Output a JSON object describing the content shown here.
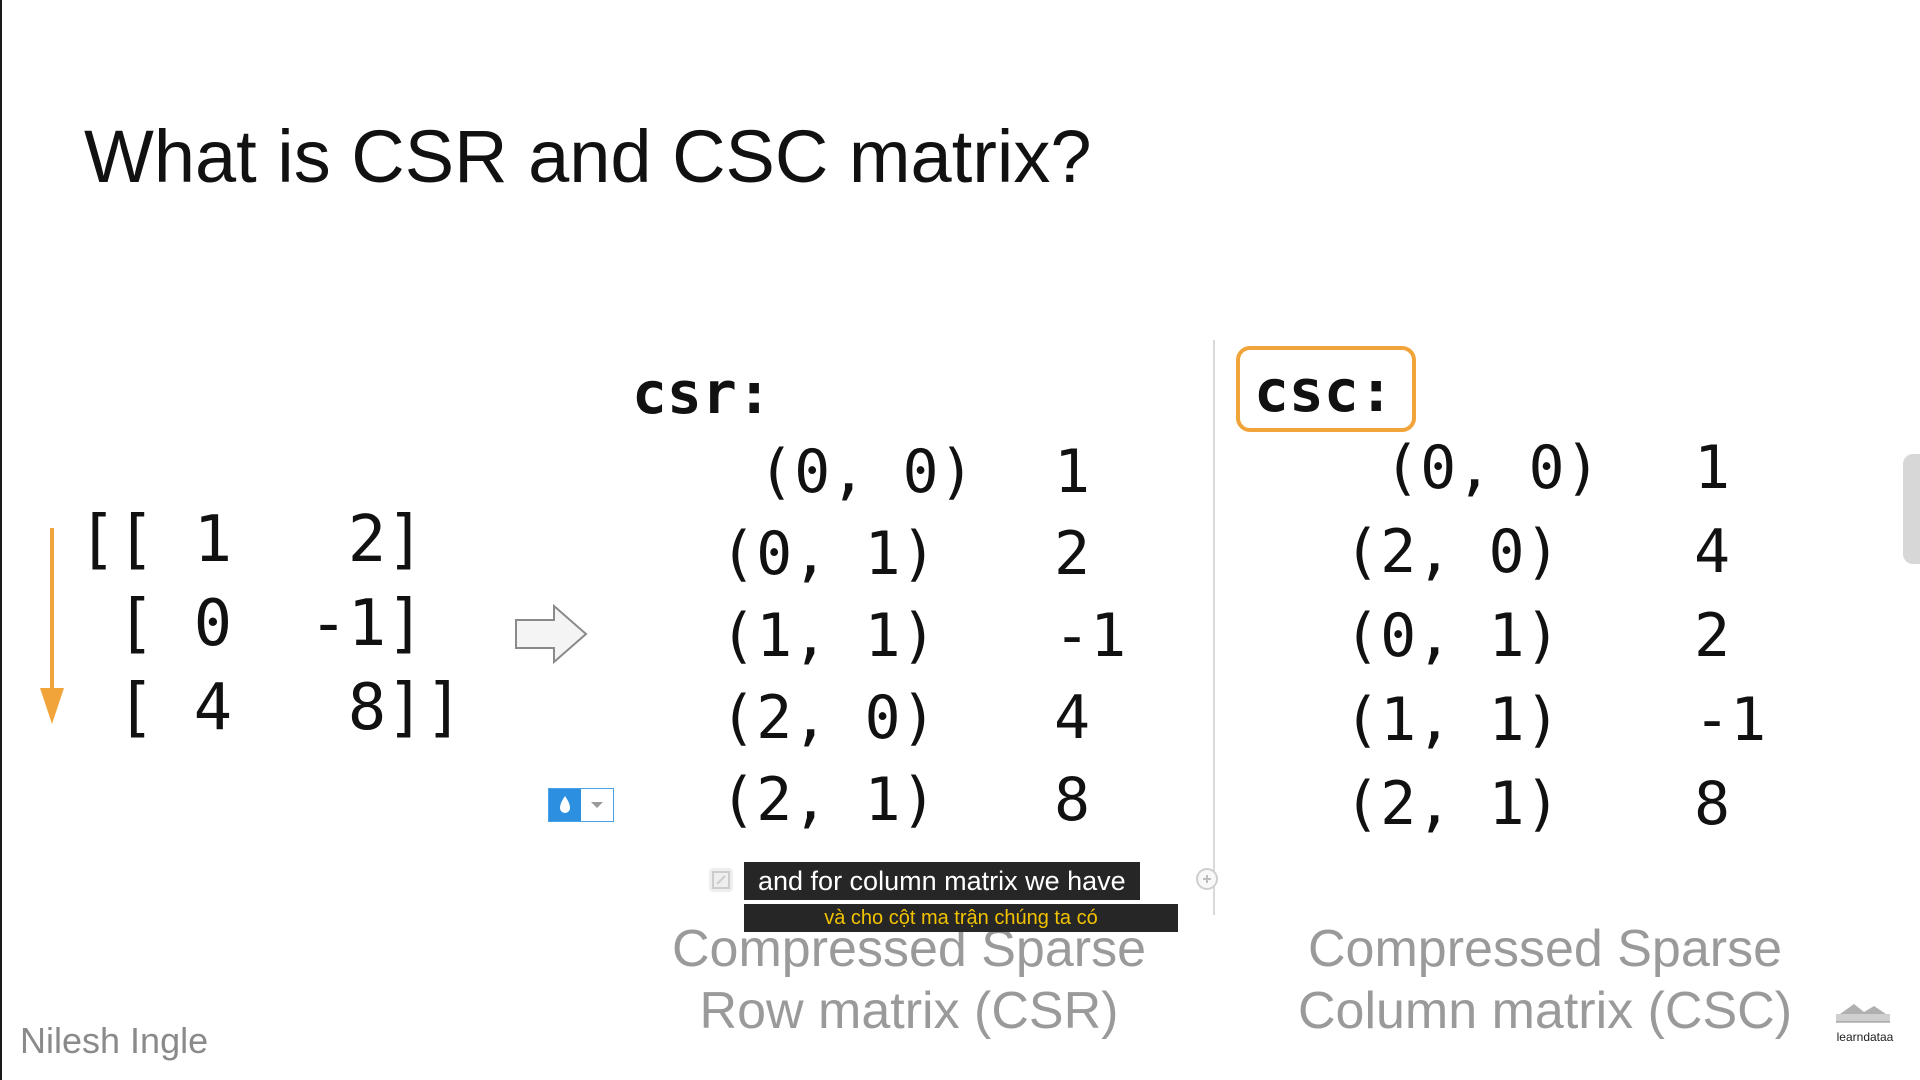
{
  "slide": {
    "title": "What is CSR and CSC matrix?",
    "author": "Nilesh Ingle"
  },
  "matrix": {
    "rows": [
      "[[ 1   2]",
      " [ 0  -1]",
      " [ 4   8]]"
    ]
  },
  "csr": {
    "label": "csr:",
    "entries": [
      {
        "coord": "(0, 0)",
        "value": "1"
      },
      {
        "coord": "(0, 1)",
        "value": "2"
      },
      {
        "coord": "(1, 1)",
        "value": "-1"
      },
      {
        "coord": "(2, 0)",
        "value": "4"
      },
      {
        "coord": "(2, 1)",
        "value": "8"
      }
    ],
    "caption_line1": "Compressed Sparse",
    "caption_line2": "Row matrix (CSR)"
  },
  "csc": {
    "label": "csc:",
    "entries": [
      {
        "coord": "(0, 0)",
        "value": "1"
      },
      {
        "coord": "(2, 0)",
        "value": "4"
      },
      {
        "coord": "(0, 1)",
        "value": "2"
      },
      {
        "coord": "(1, 1)",
        "value": "-1"
      },
      {
        "coord": "(2, 1)",
        "value": "8"
      }
    ],
    "caption_line1": "Compressed Sparse",
    "caption_line2": "Column matrix (CSC)"
  },
  "subtitles": {
    "english": "and for column matrix we have",
    "vietnamese": "và cho cột ma trận chúng ta có"
  },
  "logo": {
    "text": "learndataa"
  },
  "colors": {
    "accent_orange": "#f0a43a",
    "widget_blue": "#2d8fe0",
    "subtitle_yellow": "#f2c200",
    "caption_gray": "#9a9a9a"
  },
  "icons": {
    "down_arrow": "orange-down-arrow-icon",
    "convert_arrow": "right-arrow-icon",
    "drop": "water-drop-icon",
    "dropdown": "chevron-down-icon",
    "expand": "expand-icon",
    "add": "plus-circle-icon"
  }
}
